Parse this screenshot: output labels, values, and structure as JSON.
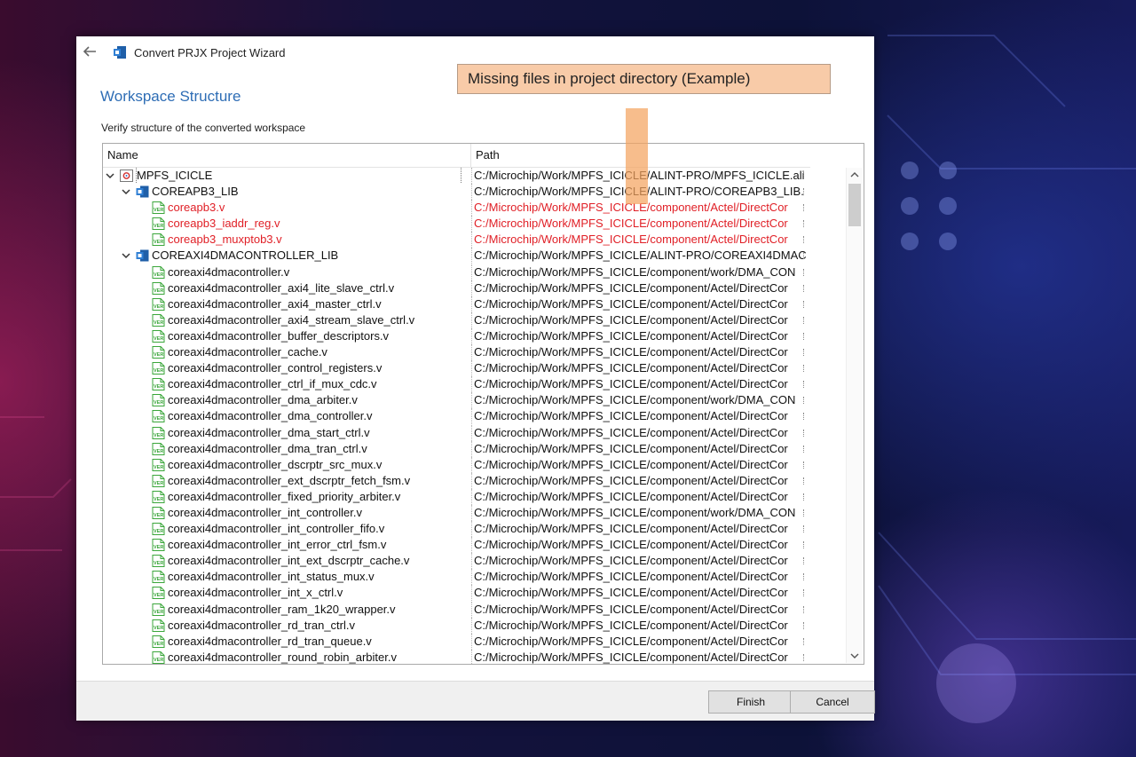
{
  "window": {
    "title": "Convert PRJX Project Wizard"
  },
  "page": {
    "title": "Workspace Structure",
    "subtitle": "Verify structure of the converted workspace"
  },
  "callout": {
    "text": "Missing files in project directory (Example)"
  },
  "grid": {
    "columns": {
      "name": "Name",
      "path": "Path"
    },
    "rows": [
      {
        "name": "MPFS_ICICLE",
        "path": "C:/Microchip/Work/MPFS_ICICLE/ALINT-PRO/MPFS_ICICLE.ali",
        "level": 0,
        "kind": "workspace",
        "expanded": true,
        "missing": false
      },
      {
        "name": "COREAPB3_LIB",
        "path": "C:/Microchip/Work/MPFS_ICICLE/ALINT-PRO/COREAPB3_LIB.",
        "level": 1,
        "kind": "library",
        "expanded": true,
        "missing": false
      },
      {
        "name": "coreapb3.v",
        "path": "C:/Microchip/Work/MPFS_ICICLE/component/Actel/DirectCor",
        "level": 2,
        "kind": "file",
        "missing": true
      },
      {
        "name": "coreapb3_iaddr_reg.v",
        "path": "C:/Microchip/Work/MPFS_ICICLE/component/Actel/DirectCor",
        "level": 2,
        "kind": "file",
        "missing": true
      },
      {
        "name": "coreapb3_muxptob3.v",
        "path": "C:/Microchip/Work/MPFS_ICICLE/component/Actel/DirectCor",
        "level": 2,
        "kind": "file",
        "missing": true
      },
      {
        "name": "COREAXI4DMACONTROLLER_LIB",
        "path": "C:/Microchip/Work/MPFS_ICICLE/ALINT-PRO/COREAXI4DMAC",
        "level": 1,
        "kind": "library",
        "expanded": true,
        "missing": false
      },
      {
        "name": "coreaxi4dmacontroller.v",
        "path": "C:/Microchip/Work/MPFS_ICICLE/component/work/DMA_CON",
        "level": 2,
        "kind": "file",
        "missing": false
      },
      {
        "name": "coreaxi4dmacontroller_axi4_lite_slave_ctrl.v",
        "path": "C:/Microchip/Work/MPFS_ICICLE/component/Actel/DirectCor",
        "level": 2,
        "kind": "file",
        "missing": false
      },
      {
        "name": "coreaxi4dmacontroller_axi4_master_ctrl.v",
        "path": "C:/Microchip/Work/MPFS_ICICLE/component/Actel/DirectCor",
        "level": 2,
        "kind": "file",
        "missing": false
      },
      {
        "name": "coreaxi4dmacontroller_axi4_stream_slave_ctrl.v",
        "path": "C:/Microchip/Work/MPFS_ICICLE/component/Actel/DirectCor",
        "level": 2,
        "kind": "file",
        "missing": false
      },
      {
        "name": "coreaxi4dmacontroller_buffer_descriptors.v",
        "path": "C:/Microchip/Work/MPFS_ICICLE/component/Actel/DirectCor",
        "level": 2,
        "kind": "file",
        "missing": false
      },
      {
        "name": "coreaxi4dmacontroller_cache.v",
        "path": "C:/Microchip/Work/MPFS_ICICLE/component/Actel/DirectCor",
        "level": 2,
        "kind": "file",
        "missing": false
      },
      {
        "name": "coreaxi4dmacontroller_control_registers.v",
        "path": "C:/Microchip/Work/MPFS_ICICLE/component/Actel/DirectCor",
        "level": 2,
        "kind": "file",
        "missing": false
      },
      {
        "name": "coreaxi4dmacontroller_ctrl_if_mux_cdc.v",
        "path": "C:/Microchip/Work/MPFS_ICICLE/component/Actel/DirectCor",
        "level": 2,
        "kind": "file",
        "missing": false
      },
      {
        "name": "coreaxi4dmacontroller_dma_arbiter.v",
        "path": "C:/Microchip/Work/MPFS_ICICLE/component/work/DMA_CON",
        "level": 2,
        "kind": "file",
        "missing": false
      },
      {
        "name": "coreaxi4dmacontroller_dma_controller.v",
        "path": "C:/Microchip/Work/MPFS_ICICLE/component/Actel/DirectCor",
        "level": 2,
        "kind": "file",
        "missing": false
      },
      {
        "name": "coreaxi4dmacontroller_dma_start_ctrl.v",
        "path": "C:/Microchip/Work/MPFS_ICICLE/component/Actel/DirectCor",
        "level": 2,
        "kind": "file",
        "missing": false
      },
      {
        "name": "coreaxi4dmacontroller_dma_tran_ctrl.v",
        "path": "C:/Microchip/Work/MPFS_ICICLE/component/Actel/DirectCor",
        "level": 2,
        "kind": "file",
        "missing": false
      },
      {
        "name": "coreaxi4dmacontroller_dscrptr_src_mux.v",
        "path": "C:/Microchip/Work/MPFS_ICICLE/component/Actel/DirectCor",
        "level": 2,
        "kind": "file",
        "missing": false
      },
      {
        "name": "coreaxi4dmacontroller_ext_dscrptr_fetch_fsm.v",
        "path": "C:/Microchip/Work/MPFS_ICICLE/component/Actel/DirectCor",
        "level": 2,
        "kind": "file",
        "missing": false
      },
      {
        "name": "coreaxi4dmacontroller_fixed_priority_arbiter.v",
        "path": "C:/Microchip/Work/MPFS_ICICLE/component/Actel/DirectCor",
        "level": 2,
        "kind": "file",
        "missing": false
      },
      {
        "name": "coreaxi4dmacontroller_int_controller.v",
        "path": "C:/Microchip/Work/MPFS_ICICLE/component/work/DMA_CON",
        "level": 2,
        "kind": "file",
        "missing": false
      },
      {
        "name": "coreaxi4dmacontroller_int_controller_fifo.v",
        "path": "C:/Microchip/Work/MPFS_ICICLE/component/Actel/DirectCor",
        "level": 2,
        "kind": "file",
        "missing": false
      },
      {
        "name": "coreaxi4dmacontroller_int_error_ctrl_fsm.v",
        "path": "C:/Microchip/Work/MPFS_ICICLE/component/Actel/DirectCor",
        "level": 2,
        "kind": "file",
        "missing": false
      },
      {
        "name": "coreaxi4dmacontroller_int_ext_dscrptr_cache.v",
        "path": "C:/Microchip/Work/MPFS_ICICLE/component/Actel/DirectCor",
        "level": 2,
        "kind": "file",
        "missing": false
      },
      {
        "name": "coreaxi4dmacontroller_int_status_mux.v",
        "path": "C:/Microchip/Work/MPFS_ICICLE/component/Actel/DirectCor",
        "level": 2,
        "kind": "file",
        "missing": false
      },
      {
        "name": "coreaxi4dmacontroller_int_x_ctrl.v",
        "path": "C:/Microchip/Work/MPFS_ICICLE/component/Actel/DirectCor",
        "level": 2,
        "kind": "file",
        "missing": false
      },
      {
        "name": "coreaxi4dmacontroller_ram_1k20_wrapper.v",
        "path": "C:/Microchip/Work/MPFS_ICICLE/component/Actel/DirectCor",
        "level": 2,
        "kind": "file",
        "missing": false
      },
      {
        "name": "coreaxi4dmacontroller_rd_tran_ctrl.v",
        "path": "C:/Microchip/Work/MPFS_ICICLE/component/Actel/DirectCor",
        "level": 2,
        "kind": "file",
        "missing": false
      },
      {
        "name": "coreaxi4dmacontroller_rd_tran_queue.v",
        "path": "C:/Microchip/Work/MPFS_ICICLE/component/Actel/DirectCor",
        "level": 2,
        "kind": "file",
        "missing": false
      },
      {
        "name": "coreaxi4dmacontroller_round_robin_arbiter.v",
        "path": "C:/Microchip/Work/MPFS_ICICLE/component/Actel/DirectCor",
        "level": 2,
        "kind": "file",
        "missing": false
      }
    ]
  },
  "footer": {
    "finish_label": "Finish",
    "cancel_label": "Cancel"
  },
  "colors": {
    "accent": "#2e6db5",
    "missing_file": "#e01f26",
    "callout_bg": "#f8cba8",
    "file_icon": "#3aa63a"
  },
  "icons": {
    "back": "back-arrow-icon",
    "app": "app-icon",
    "workspace": "workspace-icon",
    "library": "library-icon",
    "file": "verilog-file-icon"
  }
}
